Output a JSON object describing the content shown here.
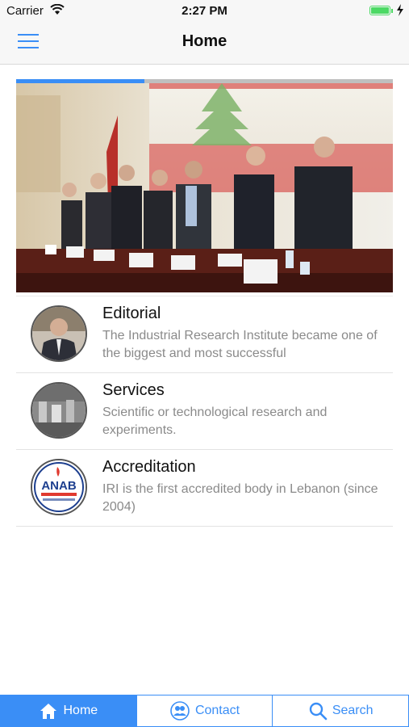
{
  "status_bar": {
    "carrier": "Carrier",
    "time": "2:27 PM",
    "battery_color": "#4cd964"
  },
  "nav": {
    "title": "Home",
    "menu_icon": "hamburger-menu-icon"
  },
  "hero": {
    "image_progress": 0.34,
    "accent_color": "#3a8ef6"
  },
  "list": {
    "items": [
      {
        "title": "Editorial",
        "description": "The Industrial Research Institute became one of the biggest and most successful",
        "thumbnail": "portrait-photo"
      },
      {
        "title": "Services",
        "description": "Scientific or technological research and experiments.",
        "thumbnail": "lab-equipment-photo"
      },
      {
        "title": "Accreditation",
        "description": "IRI is the first accredited body in Lebanon (since 2004)",
        "thumbnail": "anab-logo",
        "logo_text": "ANAB"
      }
    ]
  },
  "tab_bar": {
    "tabs": [
      {
        "label": "Home",
        "icon": "home-icon",
        "active": true
      },
      {
        "label": "Contact",
        "icon": "contact-icon",
        "active": false
      },
      {
        "label": "Search",
        "icon": "search-icon",
        "active": false
      }
    ]
  },
  "colors": {
    "accent": "#3a8ef6",
    "title_text": "#111111",
    "description_text": "#8a8a8a"
  }
}
